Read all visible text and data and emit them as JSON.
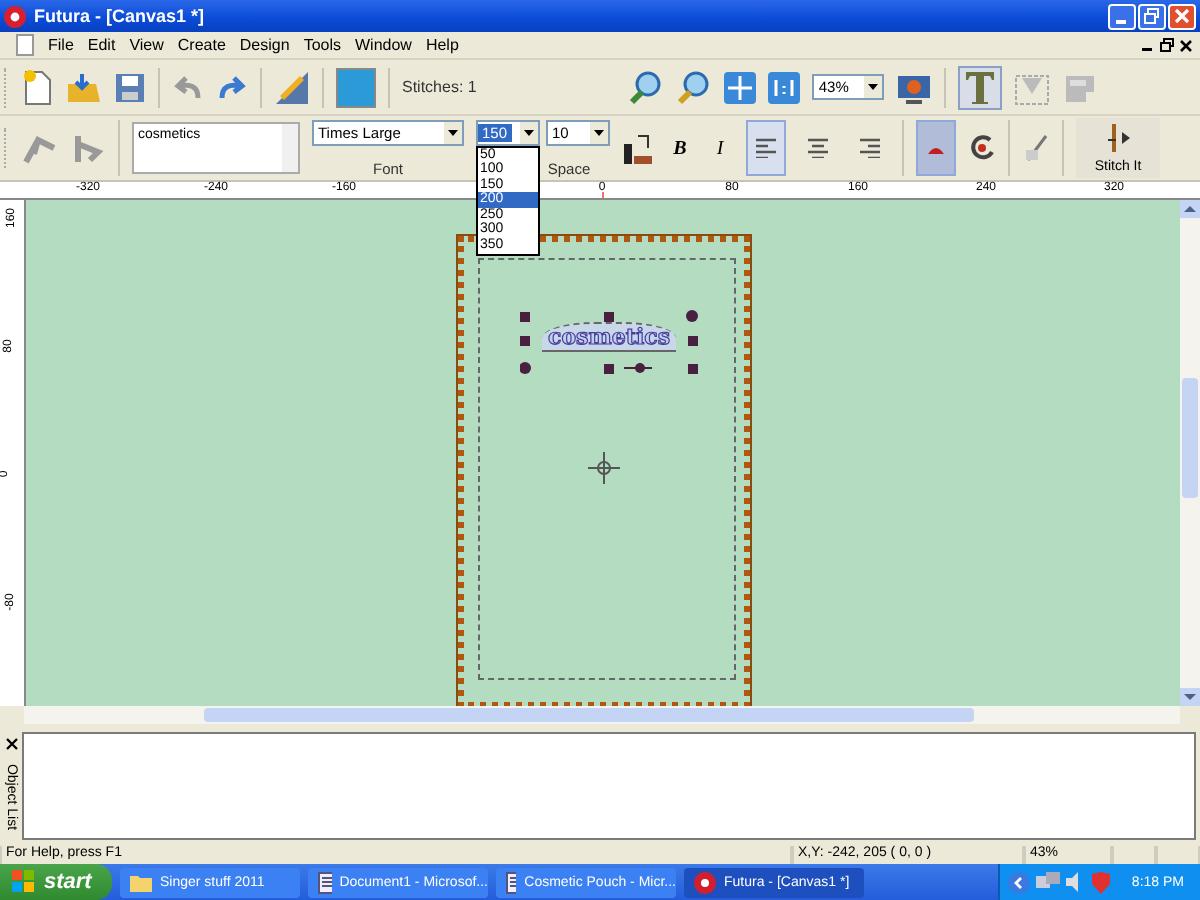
{
  "window": {
    "title": "Futura - [Canvas1 *]"
  },
  "menu": [
    "File",
    "Edit",
    "View",
    "Create",
    "Design",
    "Tools",
    "Window",
    "Help"
  ],
  "toolbar": {
    "stitches": "Stitches: 1",
    "zoom": "43%",
    "text_tool_pressed": true
  },
  "text_panel": {
    "text": "cosmetics",
    "font": "Times Large",
    "font_label": "Font",
    "size": "150",
    "size_options": [
      {
        "label": "50",
        "selected": false
      },
      {
        "label": "100",
        "selected": false
      },
      {
        "label": "150",
        "selected": false
      },
      {
        "label": "200",
        "selected": true
      },
      {
        "label": "250",
        "selected": false
      },
      {
        "label": "300",
        "selected": false
      },
      {
        "label": "350",
        "selected": false
      }
    ],
    "bold": "B",
    "italic": "I",
    "space": "10",
    "space_label": "Space",
    "alignment": [
      {
        "selected": true
      },
      {
        "selected": false
      },
      {
        "selected": false
      }
    ],
    "color_pressed": true,
    "stitch_label": "Stitch It"
  },
  "ruler": {
    "x_labels": [
      "-320",
      "-240",
      "-160",
      "0",
      "80",
      "160",
      "240",
      "320"
    ],
    "y_labels": [
      "160",
      "80",
      "0",
      "-80"
    ]
  },
  "design": {
    "text": "cosmetics"
  },
  "object_list": {
    "title": "Object List"
  },
  "status_bar": {
    "help": "For Help, press F1",
    "coords": "X,Y: -242, 205  ( 0, 0 )",
    "zoom": "43%"
  },
  "taskbar": {
    "start": "start",
    "buttons": [
      {
        "label": "Singer stuff 2011",
        "kind": "folder",
        "selected": false
      },
      {
        "label": "Document1 - Microsof...",
        "kind": "doc",
        "selected": false
      },
      {
        "label": "Cosmetic Pouch - Micr...",
        "kind": "doc",
        "selected": false
      },
      {
        "label": "Futura - [Canvas1 *]",
        "kind": "app",
        "selected": true
      }
    ],
    "clock": "8:18 PM"
  }
}
